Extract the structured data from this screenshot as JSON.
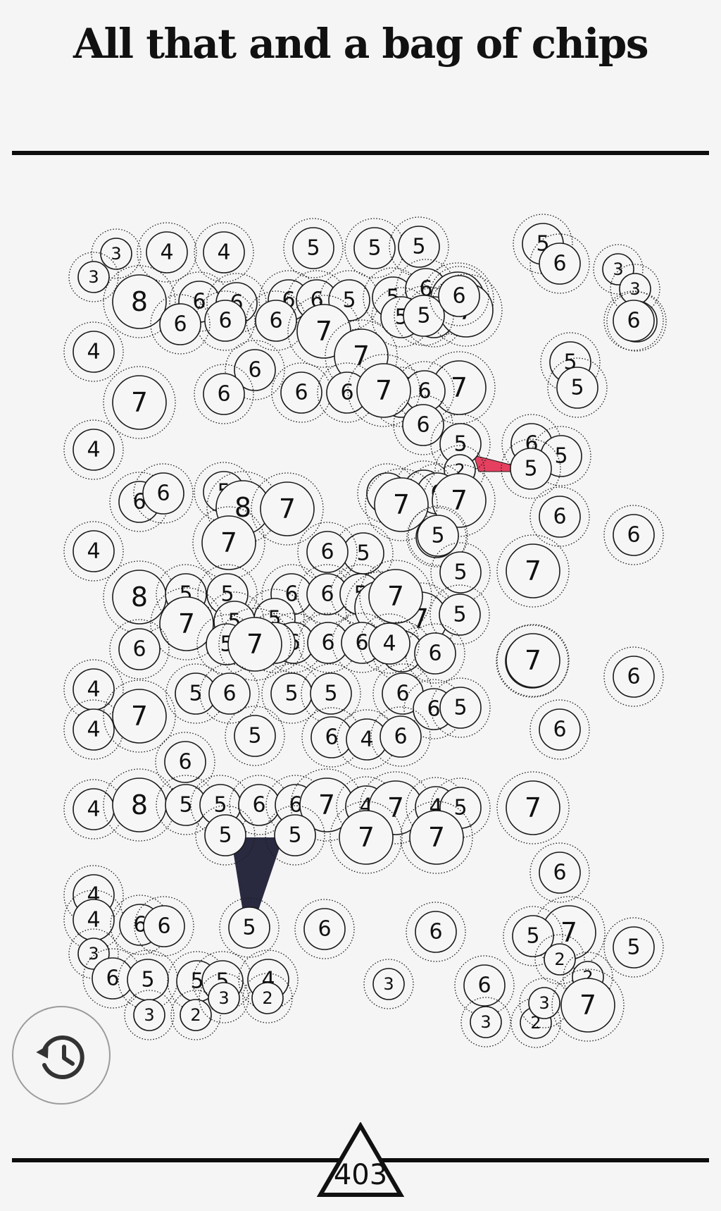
{
  "title": "All that and a bag of chips",
  "score": "403",
  "colors": {
    "background": "#f6f5f6",
    "chip_stroke": "#1a1a1a",
    "chip_fill": "#f7f6f7",
    "pointer_red": "#e5405f",
    "pointer_dark": "#292a40"
  },
  "icons": {
    "history": "history-icon",
    "score": "triangle-icon"
  },
  "chips": [
    {
      "v": "3",
      "s": "s"
    },
    {
      "v": "3",
      "s": "s"
    },
    {
      "v": "4",
      "s": "m"
    },
    {
      "v": "4",
      "s": "m"
    },
    {
      "v": "5",
      "s": "m"
    },
    {
      "v": "5",
      "s": "m"
    },
    {
      "v": "5",
      "s": "m"
    },
    {
      "v": "5",
      "s": "m"
    },
    {
      "v": "6",
      "s": "m"
    },
    {
      "v": "3",
      "s": "s"
    },
    {
      "v": "3",
      "s": "s"
    },
    {
      "v": "8",
      "s": "l"
    },
    {
      "v": "6",
      "s": "m"
    },
    {
      "v": "6",
      "s": "m"
    },
    {
      "v": "6",
      "s": "m"
    },
    {
      "v": "6",
      "s": "m"
    },
    {
      "v": "5",
      "s": "m"
    },
    {
      "v": "5",
      "s": "m"
    },
    {
      "v": "6",
      "s": "m"
    },
    {
      "v": "7",
      "s": "l"
    },
    {
      "v": "6",
      "s": "m"
    },
    {
      "v": "7",
      "s": "l"
    },
    {
      "v": "5",
      "s": "m"
    },
    {
      "v": "5",
      "s": "m"
    },
    {
      "v": "6",
      "s": "m"
    },
    {
      "v": "6",
      "s": "m"
    },
    {
      "v": "6",
      "s": "m"
    },
    {
      "v": "6",
      "s": "m"
    },
    {
      "v": "4",
      "s": "m"
    },
    {
      "v": "7",
      "s": "l"
    },
    {
      "v": "7",
      "s": "l"
    },
    {
      "v": "6",
      "s": "m"
    },
    {
      "v": "5",
      "s": "m"
    },
    {
      "v": "7",
      "s": "l"
    },
    {
      "v": "6",
      "s": "m"
    },
    {
      "v": "6",
      "s": "m"
    },
    {
      "v": "6",
      "s": "m"
    },
    {
      "v": "5",
      "s": "m"
    },
    {
      "v": "7",
      "s": "l"
    },
    {
      "v": "6",
      "s": "m"
    },
    {
      "v": "7",
      "s": "l"
    },
    {
      "v": "6",
      "s": "m"
    },
    {
      "v": "5",
      "s": "m"
    },
    {
      "v": "6",
      "s": "m"
    },
    {
      "v": "6",
      "s": "m"
    },
    {
      "v": "4",
      "s": "m"
    },
    {
      "v": "5",
      "s": "m"
    },
    {
      "v": "2",
      "s": "s"
    },
    {
      "v": "6",
      "s": "m"
    },
    {
      "v": "5",
      "s": "m"
    },
    {
      "v": "5",
      "s": "m"
    },
    {
      "v": "6",
      "s": "m"
    },
    {
      "v": "6",
      "s": "m"
    },
    {
      "v": "5",
      "s": "m"
    },
    {
      "v": "8",
      "s": "l"
    },
    {
      "v": "7",
      "s": "l"
    },
    {
      "v": "5",
      "s": "m"
    },
    {
      "v": "6",
      "s": "m"
    },
    {
      "v": "6",
      "s": "m"
    },
    {
      "v": "7",
      "s": "l"
    },
    {
      "v": "7",
      "s": "l"
    },
    {
      "v": "6",
      "s": "m"
    },
    {
      "v": "5",
      "s": "m"
    },
    {
      "v": "4",
      "s": "m"
    },
    {
      "v": "6",
      "s": "m"
    },
    {
      "v": "7",
      "s": "l"
    },
    {
      "v": "6",
      "s": "m"
    },
    {
      "v": "5",
      "s": "m"
    },
    {
      "v": "6",
      "s": "m"
    },
    {
      "v": "7",
      "s": "l"
    },
    {
      "v": "5",
      "s": "m"
    },
    {
      "v": "8",
      "s": "l"
    },
    {
      "v": "5",
      "s": "m"
    },
    {
      "v": "5",
      "s": "m"
    },
    {
      "v": "6",
      "s": "m"
    },
    {
      "v": "6",
      "s": "m"
    },
    {
      "v": "5",
      "s": "m"
    },
    {
      "v": "8",
      "s": "l"
    },
    {
      "v": "5",
      "s": "m"
    },
    {
      "v": "7",
      "s": "l"
    },
    {
      "v": "5",
      "s": "m"
    },
    {
      "v": "7",
      "s": "l"
    },
    {
      "v": "5",
      "s": "m"
    },
    {
      "v": "7",
      "s": "l"
    },
    {
      "v": "7",
      "s": "l"
    },
    {
      "v": "6",
      "s": "m"
    },
    {
      "v": "6",
      "s": "m"
    },
    {
      "v": "6",
      "s": "m"
    },
    {
      "v": "6",
      "s": "m"
    },
    {
      "v": "5",
      "s": "m"
    },
    {
      "v": "6",
      "s": "m"
    },
    {
      "v": "6",
      "s": "m"
    },
    {
      "v": "5",
      "s": "m"
    },
    {
      "v": "7",
      "s": "l"
    },
    {
      "v": "4",
      "s": "m"
    },
    {
      "v": "4",
      "s": "m"
    },
    {
      "v": "4",
      "s": "m"
    },
    {
      "v": "7",
      "s": "l"
    },
    {
      "v": "5",
      "s": "m"
    },
    {
      "v": "6",
      "s": "m"
    },
    {
      "v": "5",
      "s": "m"
    },
    {
      "v": "5",
      "s": "m"
    },
    {
      "v": "6",
      "s": "m"
    },
    {
      "v": "6",
      "s": "m"
    },
    {
      "v": "5",
      "s": "m"
    },
    {
      "v": "6",
      "s": "m"
    },
    {
      "v": "7",
      "s": "l"
    },
    {
      "v": "4",
      "s": "m"
    },
    {
      "v": "6",
      "s": "m"
    },
    {
      "v": "6",
      "s": "m"
    },
    {
      "v": "6",
      "s": "m"
    },
    {
      "v": "5",
      "s": "m"
    },
    {
      "v": "6",
      "s": "m"
    },
    {
      "v": "4",
      "s": "m"
    },
    {
      "v": "8",
      "s": "l"
    },
    {
      "v": "5",
      "s": "m"
    },
    {
      "v": "5",
      "s": "m"
    },
    {
      "v": "6",
      "s": "m"
    },
    {
      "v": "6",
      "s": "m"
    },
    {
      "v": "7",
      "s": "l"
    },
    {
      "v": "4",
      "s": "m"
    },
    {
      "v": "7",
      "s": "l"
    },
    {
      "v": "4",
      "s": "m"
    },
    {
      "v": "5",
      "s": "m"
    },
    {
      "v": "7",
      "s": "l"
    },
    {
      "v": "5",
      "s": "m"
    },
    {
      "v": "5",
      "s": "m"
    },
    {
      "v": "7",
      "s": "l"
    },
    {
      "v": "7",
      "s": "l"
    },
    {
      "v": "6",
      "s": "m"
    },
    {
      "v": "4",
      "s": "m"
    },
    {
      "v": "4",
      "s": "m"
    },
    {
      "v": "6",
      "s": "m"
    },
    {
      "v": "6",
      "s": "m"
    },
    {
      "v": "5",
      "s": "m"
    },
    {
      "v": "6",
      "s": "m"
    },
    {
      "v": "6",
      "s": "m"
    },
    {
      "v": "7",
      "s": "l"
    },
    {
      "v": "5",
      "s": "m"
    },
    {
      "v": "3",
      "s": "s"
    },
    {
      "v": "3",
      "s": "s"
    },
    {
      "v": "6",
      "s": "m"
    },
    {
      "v": "5",
      "s": "m"
    },
    {
      "v": "5",
      "s": "m"
    },
    {
      "v": "5",
      "s": "m"
    },
    {
      "v": "4",
      "s": "m"
    },
    {
      "v": "6",
      "s": "m"
    },
    {
      "v": "5",
      "s": "m"
    },
    {
      "v": "2",
      "s": "s"
    },
    {
      "v": "2",
      "s": "s"
    },
    {
      "v": "3",
      "s": "s"
    },
    {
      "v": "2",
      "s": "s"
    },
    {
      "v": "3",
      "s": "s"
    },
    {
      "v": "2",
      "s": "s"
    },
    {
      "v": "3",
      "s": "s"
    },
    {
      "v": "2",
      "s": "s"
    },
    {
      "v": "3",
      "s": "s"
    },
    {
      "v": "7",
      "s": "l"
    }
  ]
}
